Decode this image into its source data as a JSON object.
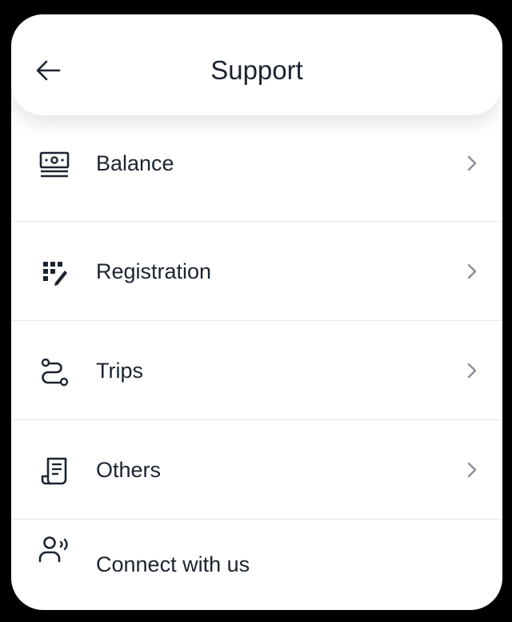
{
  "header": {
    "title": "Support",
    "back_icon": "arrow-left-icon"
  },
  "menu": {
    "items": [
      {
        "label": "Balance",
        "icon": "cash-icon",
        "has_chevron": true
      },
      {
        "label": "Registration",
        "icon": "form-edit-icon",
        "has_chevron": true
      },
      {
        "label": "Trips",
        "icon": "route-icon",
        "has_chevron": true
      },
      {
        "label": "Others",
        "icon": "receipt-icon",
        "has_chevron": true
      },
      {
        "label": "Connect with us",
        "icon": "user-voice-icon",
        "has_chevron": false
      }
    ]
  },
  "colors": {
    "text": "#1b2431",
    "chevron": "#8a8f98",
    "divider": "#e6e7e9",
    "background": "#ffffff"
  }
}
